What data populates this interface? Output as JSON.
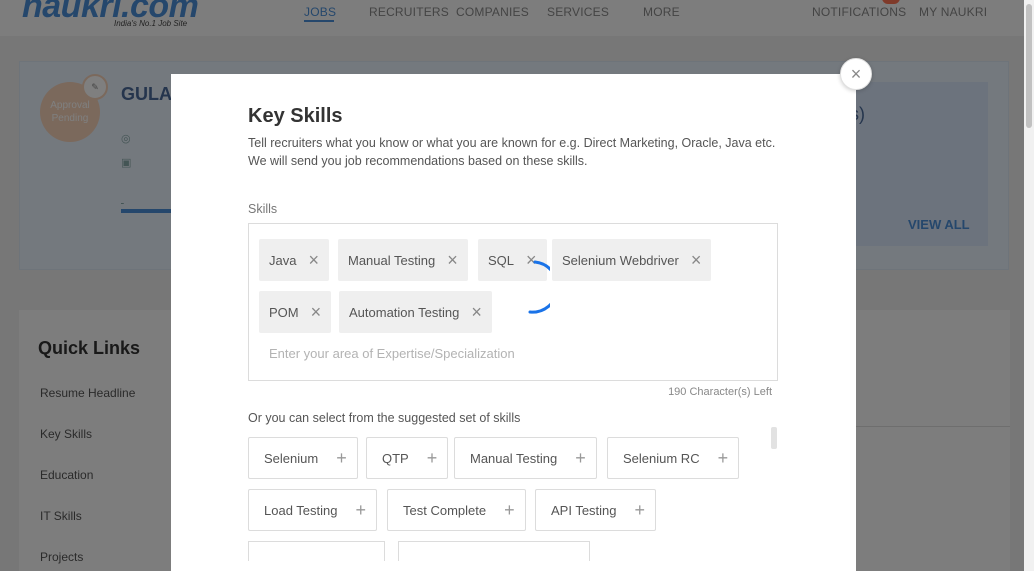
{
  "logo": {
    "name": "naukri.com",
    "tagline": "India's No.1 Job Site"
  },
  "nav": {
    "items": [
      "JOBS",
      "RECRUITERS",
      "COMPANIES",
      "SERVICES",
      "MORE"
    ],
    "notifications": "NOTIFICATIONS",
    "my_naukri": "MY NAUKRI"
  },
  "profile": {
    "avatar_status": "Approval Pending",
    "name_partial": "GULA",
    "right_card_title": "s)",
    "view_all": "VIEW ALL"
  },
  "quick_links": {
    "title": "Quick Links",
    "items": [
      "Resume Headline",
      "Key Skills",
      "Education",
      "IT Skills",
      "Projects"
    ]
  },
  "modal": {
    "title": "Key Skills",
    "description": "Tell recruiters what you know or what you are known for e.g. Direct Marketing, Oracle, Java etc. We will send you job recommendations based on these skills.",
    "skills_label": "Skills",
    "selected_skills": [
      "Java",
      "Manual Testing",
      "SQL",
      "Selenium Webdriver",
      "POM",
      "Automation Testing"
    ],
    "input_placeholder": "Enter your area of Expertise/Specialization",
    "chars_left": "190 Character(s) Left",
    "suggest_label": "Or you can select from the suggested set of skills",
    "suggested_skills": [
      "Selenium",
      "QTP",
      "Manual Testing",
      "Selenium RC",
      "Load Testing",
      "Test Complete",
      "API Testing"
    ],
    "close_icon": "close-icon",
    "remove_icon": "close-icon",
    "add_icon": "plus-icon"
  },
  "colors": {
    "brand": "#4a8fd9",
    "spinner": "#1a73e8"
  }
}
